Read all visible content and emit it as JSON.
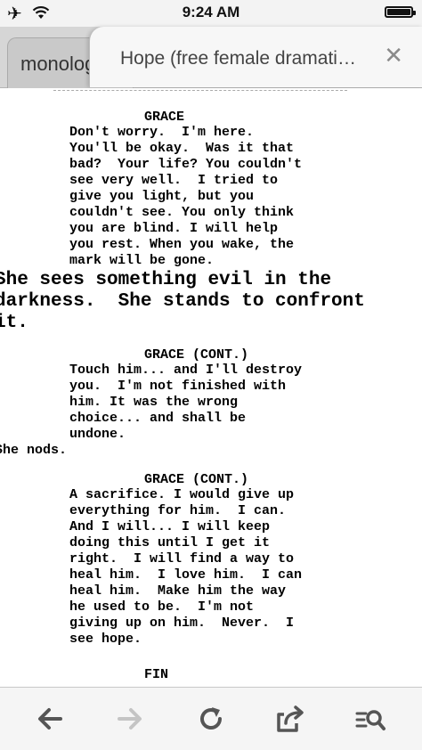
{
  "status_bar": {
    "time": "9:24 AM",
    "airplane_icon": "✈",
    "battery_level": 1.0
  },
  "tabs": [
    {
      "label": "monologues",
      "active": false
    },
    {
      "label": "Hope (free female dramati…",
      "active": true
    }
  ],
  "close_icon": "✕",
  "script": {
    "blocks": [
      {
        "type": "character",
        "text": "GRACE"
      },
      {
        "type": "dialogue",
        "lines": [
          "Don't worry.  I'm here.",
          "You'll be okay.  Was it that",
          "bad?  Your life? You couldn't",
          "see very well.  I tried to",
          "give you light, but you",
          "couldn't see. You only think",
          "you are blind. I will help",
          "you rest. When you wake, the",
          "mark will be gone."
        ]
      },
      {
        "type": "action_large",
        "lines": [
          "She sees something evil in the",
          "darkness.  She stands to confront",
          "it."
        ]
      },
      {
        "type": "character",
        "text": "GRACE (CONT.)"
      },
      {
        "type": "dialogue",
        "lines": [
          "Touch him... and I'll destroy",
          "you.  I'm not finished with",
          "him. It was the wrong",
          "choice... and shall be",
          "undone."
        ]
      },
      {
        "type": "action_small",
        "lines": [
          "She nods."
        ]
      },
      {
        "type": "character",
        "text": "GRACE (CONT.)"
      },
      {
        "type": "dialogue",
        "lines": [
          "A sacrifice. I would give up",
          "everything for him.  I can.",
          "And I will... I will keep",
          "doing this until I get it",
          "right.  I will find a way to",
          "heal him.  I love him.  I can",
          "heal him.  Make him the way",
          "he used to be.  I'm not",
          "giving up on him.  Never.  I",
          "see hope."
        ]
      },
      {
        "type": "character",
        "text": "FIN"
      }
    ]
  },
  "toolbar": {
    "back_icon": "arrow-left-icon",
    "forward_icon": "arrow-right-icon",
    "reload_icon": "reload-icon",
    "share_icon": "share-icon",
    "reader_icon": "reader-search-icon",
    "forward_enabled": false
  }
}
